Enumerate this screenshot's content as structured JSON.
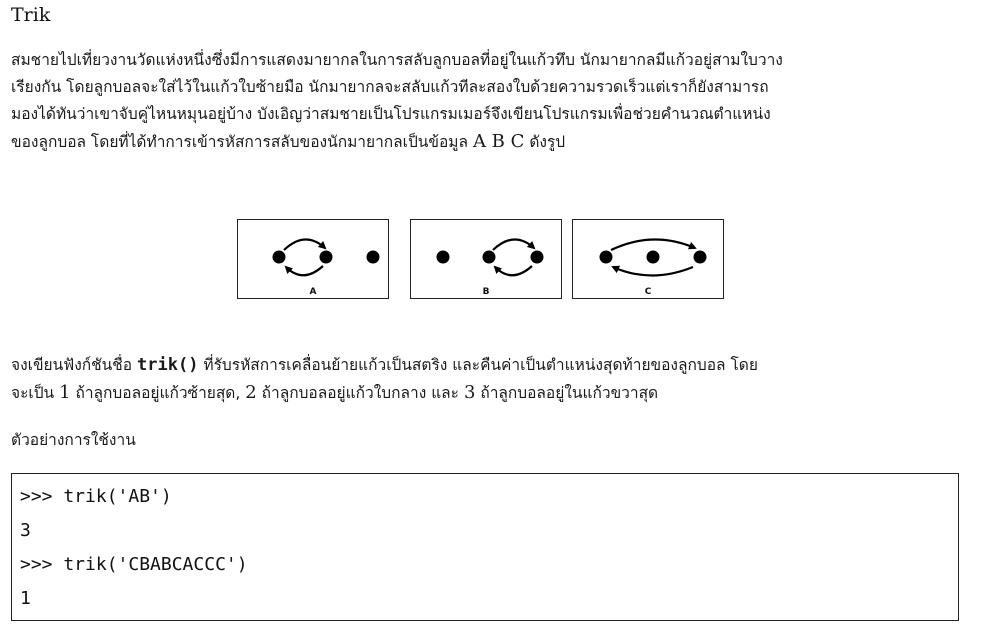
{
  "title": "Trik",
  "intro": {
    "line1": "สมชายไปเที่ยวงานวัดแห่งหนึ่งซึ่งมีการแสดงมายากลในการสลับลูกบอลที่อยู่ในแก้วทึบ นักมายากลมีแก้วอยู่สามใบวาง",
    "line2": "เรียงกัน โดยลูกบอลจะใส่ไว้ในแก้วใบซ้ายมือ นักมายากลจะสลับแก้วทีละสองใบด้วยความรวดเร็วแต่เราก็ยังสามารถ",
    "line3": "มองได้ทันว่าเขาจับคู่ไหนหมุนอยู่บ้าง  บังเอิญว่าสมชายเป็นโปรแกรมเมอร์จึงเขียนโปรแกรมเพื่อช่วยคำนวณตำแหน่ง",
    "line4_pre": "ของลูกบอล โดยที่ได้ทำการเข้ารหัสการสลับของนักมายากลเป็นข้อมูล ",
    "line4_letters": "A B C",
    "line4_post": " ดังรูป"
  },
  "diagrams": [
    {
      "label": "A",
      "swap": "left-middle"
    },
    {
      "label": "B",
      "swap": "middle-right"
    },
    {
      "label": "C",
      "swap": "left-right"
    }
  ],
  "task": {
    "line1_pre": "จงเขียนฟังก์ชันชื่อ ",
    "func": "trik()",
    "line1_post": " ที่รับรหัสการเคลื่อนย้ายแก้วเป็นสตริง และคืนค่าเป็นตำแหน่งสุดท้ายของลูกบอล โดย",
    "line2_a": "จะเป็น ",
    "n1": "1",
    "line2_b": " ถ้าลูกบอลอยู่แก้วซ้ายสุด, ",
    "n2": "2",
    "line2_c": " ถ้าลูกบอลอยู่แก้วใบกลาง และ ",
    "n3": "3",
    "line2_d": " ถ้าลูกบอลอยู่ในแก้วขวาสุด"
  },
  "example_label": "ตัวอย่างการใช้งาน",
  "code": [
    ">>> trik('AB')",
    "3",
    ">>> trik('CBABCACCC')",
    "1"
  ]
}
